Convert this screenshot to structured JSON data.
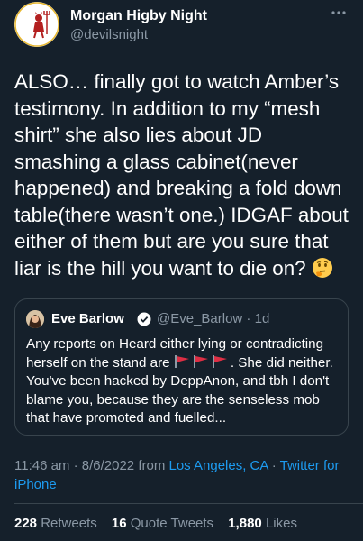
{
  "author": {
    "display_name": "Morgan Higby Night",
    "handle": "@devilsnight",
    "avatar_icon": "devil-moon-logo-icon"
  },
  "tweet": {
    "text_main": "ALSO… finally got to watch Amber’s testimony. In addition to my “mesh shirt” she also lies about JD smashing a glass cabinet(never happened) and breaking a fold down table(there wasn’t one.) IDGAF about either of them but are you sure that liar is the hill you want to die on?",
    "emoji": "thinking-face-icon"
  },
  "quoted": {
    "display_name": "Eve Barlow",
    "handle_time": "@Eve_Barlow · 1d",
    "verified_icon": "verified-badge-icon",
    "text_before_flags": "Any reports on Heard either lying or contradicting herself on the stand are",
    "flag_icon": "red-flag-icon",
    "text_after_flags": ". She did neither. You've been hacked by DeppAnon, and tbh I don't blame you, because they are the senseless mob that have promoted and fuelled..."
  },
  "meta": {
    "time": "11:46 am · 8/6/2022 from ",
    "location": "Los Angeles, CA",
    "separator": " · ",
    "source": "Twitter for iPhone"
  },
  "stats": {
    "retweets_count": "228",
    "retweets_label": "Retweets",
    "quotes_count": "16",
    "quotes_label": "Quote Tweets",
    "likes_count": "1,880",
    "likes_label": "Likes"
  },
  "colors": {
    "background": "#15202b",
    "text_secondary": "#8b98a5",
    "link": "#1d9bf0",
    "border": "#38444d"
  }
}
